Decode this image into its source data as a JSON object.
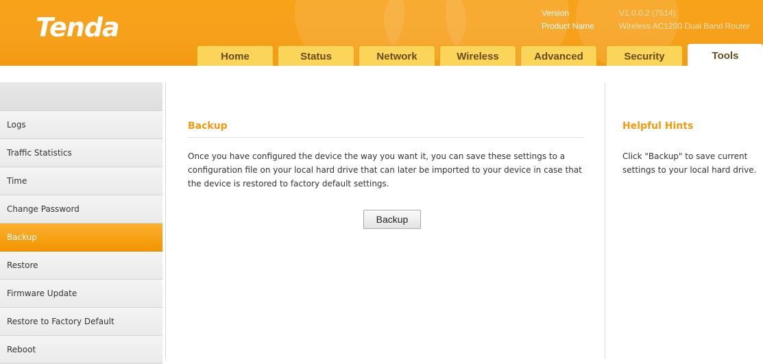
{
  "brand": {
    "logo_text": "Tenda",
    "accent": "#f7a01b"
  },
  "version": {
    "version_label": "Version",
    "version_value": "V1.0.0.2 (7514)",
    "product_label": "Product Name",
    "product_value": "Wireless AC1200 Dual Band Router"
  },
  "tabs": [
    {
      "label": "Home"
    },
    {
      "label": "Status"
    },
    {
      "label": "Network"
    },
    {
      "label": "Wireless"
    },
    {
      "label": "Advanced"
    },
    {
      "label": "Security"
    },
    {
      "label": "Tools",
      "active": true
    }
  ],
  "sidebar": {
    "items": [
      {
        "label": "Logs"
      },
      {
        "label": "Traffic Statistics"
      },
      {
        "label": "Time"
      },
      {
        "label": "Change Password"
      },
      {
        "label": "Backup",
        "active": true
      },
      {
        "label": "Restore"
      },
      {
        "label": "Firmware Update"
      },
      {
        "label": "Restore to Factory Default"
      },
      {
        "label": "Reboot"
      }
    ]
  },
  "main": {
    "title": "Backup",
    "description": "Once you have configured the device the way you want it, you can save these settings to a configuration file on your local hard drive that can later be imported to your device in case that the device is restored to factory default settings.",
    "backup_button": "Backup"
  },
  "hints": {
    "title": "Helpful Hints",
    "text": "Click \"Backup\" to save current settings to your local hard drive."
  }
}
